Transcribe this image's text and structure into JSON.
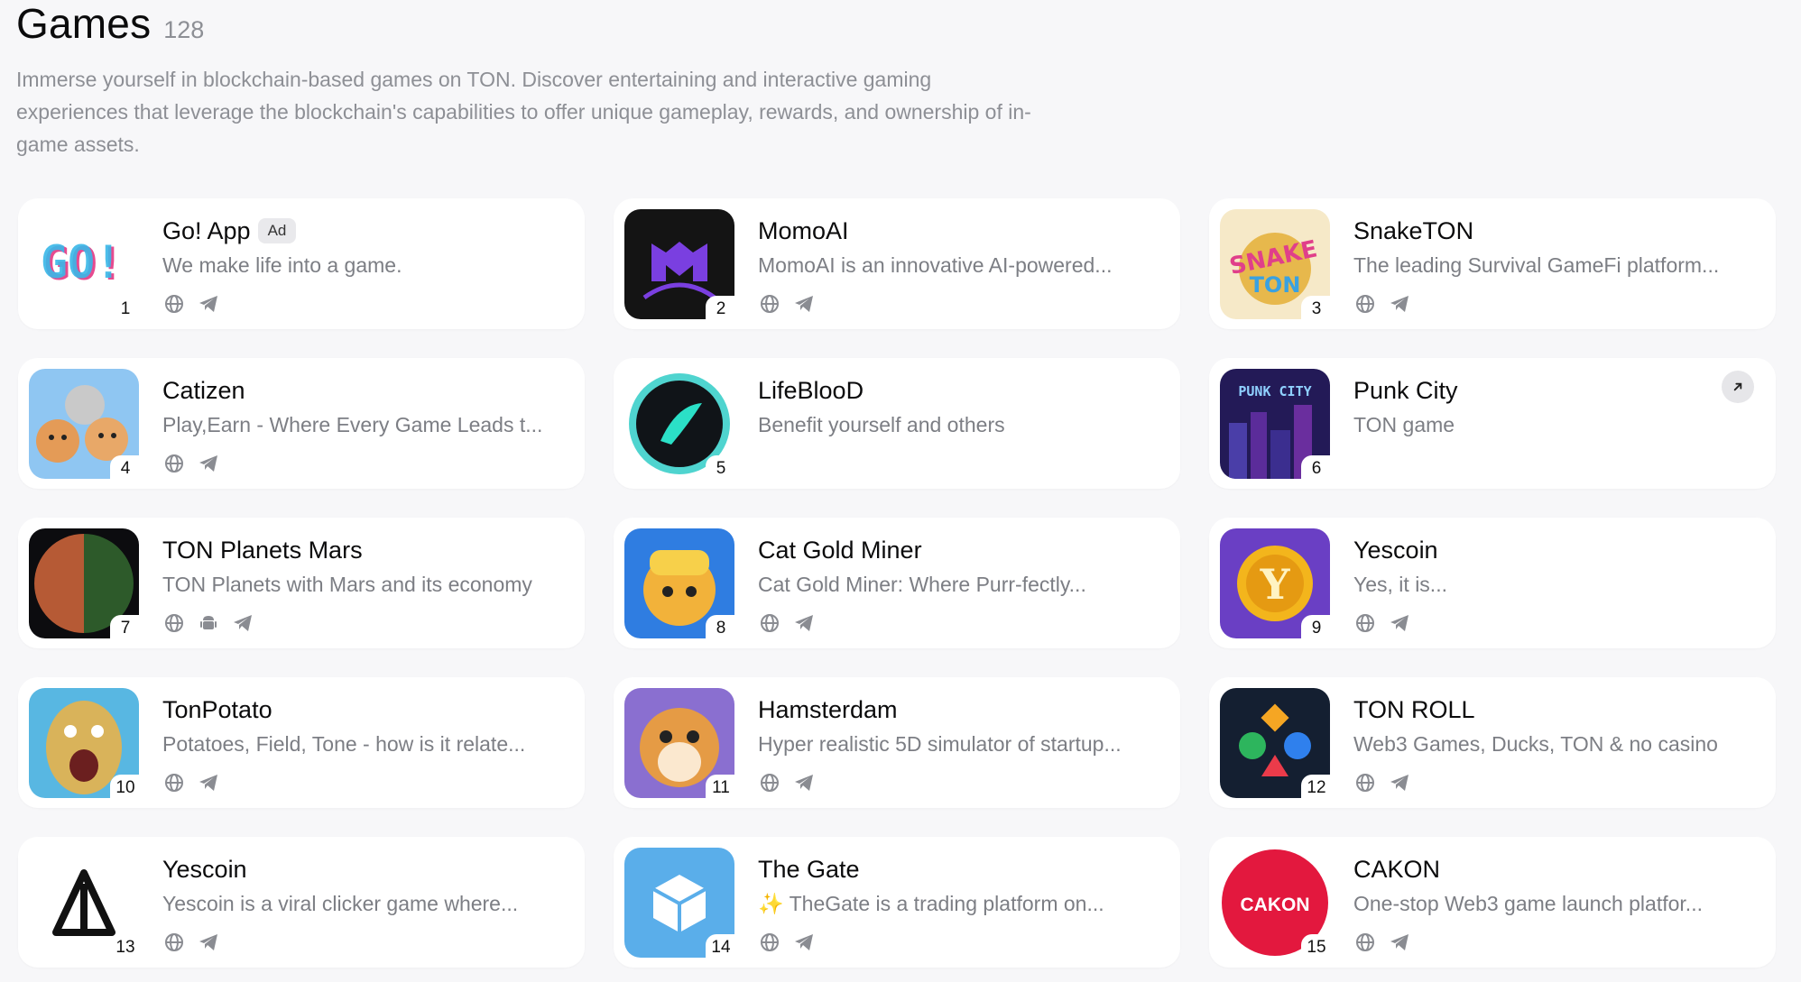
{
  "header": {
    "title": "Games",
    "count": "128",
    "description": "Immerse yourself in blockchain-based games on TON. Discover entertaining and interactive gaming experiences that leverage the blockchain's capabilities to offer unique gameplay, rewards, and ownership of in-game assets."
  },
  "apps": [
    {
      "rank": "1",
      "name": "Go! App",
      "ad": "Ad",
      "desc": "We make life into a game.",
      "links": [
        "globe-icon",
        "telegram-icon"
      ],
      "icon": "go-logo"
    },
    {
      "rank": "2",
      "name": "MomoAI",
      "desc": "MomoAI is an innovative AI-powered...",
      "links": [
        "globe-icon",
        "telegram-icon"
      ],
      "icon": "momo-logo"
    },
    {
      "rank": "3",
      "name": "SnakeTON",
      "desc": "The leading Survival GameFi platform...",
      "links": [
        "globe-icon",
        "telegram-icon"
      ],
      "icon": "snake-logo"
    },
    {
      "rank": "4",
      "name": "Catizen",
      "desc": "Play,Earn - Where Every Game Leads t...",
      "links": [
        "globe-icon",
        "telegram-icon"
      ],
      "icon": "catizen-logo"
    },
    {
      "rank": "5",
      "name": "LifeBlooD",
      "desc": "Benefit yourself and others",
      "links": [],
      "icon": "lifeblood-logo"
    },
    {
      "rank": "6",
      "name": "Punk City",
      "desc": "TON game",
      "links": [],
      "icon": "punkcity-logo",
      "external": true
    },
    {
      "rank": "7",
      "name": "TON Planets Mars",
      "desc": "TON Planets with Mars and its economy",
      "links": [
        "globe-icon",
        "android-icon",
        "telegram-icon"
      ],
      "icon": "mars-logo"
    },
    {
      "rank": "8",
      "name": "Cat Gold Miner",
      "desc": "Cat Gold Miner: Where Purr-fectly...",
      "links": [
        "globe-icon",
        "telegram-icon"
      ],
      "icon": "catgold-logo"
    },
    {
      "rank": "9",
      "name": "Yescoin",
      "desc": "Yes, it is...",
      "links": [
        "globe-icon",
        "telegram-icon"
      ],
      "icon": "yescoin-logo"
    },
    {
      "rank": "10",
      "name": "TonPotato",
      "desc": "Potatoes, Field, Tone - how is it relate...",
      "links": [
        "globe-icon",
        "telegram-icon"
      ],
      "icon": "potato-logo"
    },
    {
      "rank": "11",
      "name": "Hamsterdam",
      "desc": "Hyper realistic 5D simulator of startup...",
      "links": [
        "globe-icon",
        "telegram-icon"
      ],
      "icon": "hamster-logo"
    },
    {
      "rank": "12",
      "name": "TON ROLL",
      "desc": "Web3 Games, Ducks, TON & no casino",
      "links": [
        "globe-icon",
        "telegram-icon"
      ],
      "icon": "tonroll-logo"
    },
    {
      "rank": "13",
      "name": "Yescoin",
      "desc": "Yescoin is a viral clicker game where...",
      "links": [
        "globe-icon",
        "telegram-icon"
      ],
      "icon": "yescoin-triangle-logo"
    },
    {
      "rank": "14",
      "name": "The Gate",
      "desc": "✨ TheGate is a trading platform on...",
      "links": [
        "globe-icon",
        "telegram-icon"
      ],
      "icon": "thegate-logo"
    },
    {
      "rank": "15",
      "name": "CAKON",
      "desc": "One-stop Web3 game launch platfor...",
      "links": [
        "globe-icon",
        "telegram-icon"
      ],
      "icon": "cakon-logo",
      "icon_text": "CAKON"
    }
  ]
}
